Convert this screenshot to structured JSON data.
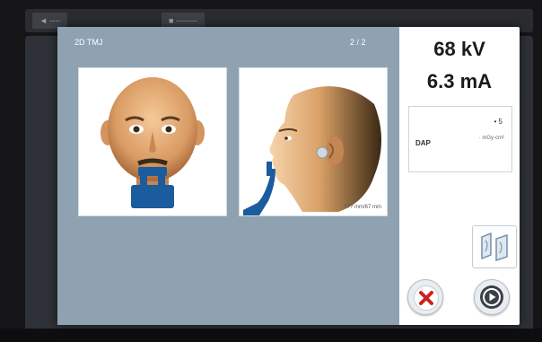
{
  "background": {
    "back_label": "◄ ----",
    "title_label": "■ --------"
  },
  "stage": {
    "title": "2D TMJ",
    "page": "2 / 2",
    "scale_note": "??? mm/67 mm"
  },
  "exposure": {
    "kv": "68 kV",
    "ma": "6.3 mA"
  },
  "dap": {
    "label": "DAP",
    "value": "• 5",
    "unit": "· mGy·cm²"
  },
  "buttons": {
    "cancel_icon": "close-icon",
    "start_icon": "play-icon",
    "view_icon": "tmj-view-icon"
  },
  "colors": {
    "stage_bg": "#8ea2b1",
    "bite_block": "#1a5c9e",
    "cancel": "#cc2222",
    "start": "#3a4048"
  }
}
